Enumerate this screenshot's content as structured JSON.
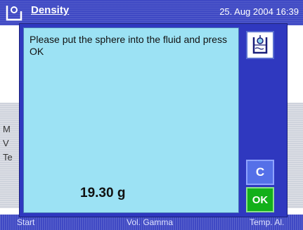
{
  "header": {
    "title": "Density",
    "date": "25. Aug 2004",
    "time": "16:39"
  },
  "background": {
    "row_labels": [
      "M",
      "V",
      "Te"
    ],
    "footer": [
      "Start",
      "Vol. Gamma",
      "Temp. Al."
    ]
  },
  "dialog": {
    "message": "Please put the sphere into the fluid and press OK",
    "weight": "19.30 g",
    "cancel_label": "C",
    "ok_label": "OK",
    "icon": "sphere-in-fluid-icon"
  },
  "colors": {
    "dialog_frame": "#2f38bf",
    "dialog_content": "#9ce2f4",
    "ok_button": "#13b01a",
    "cancel_button": "#5570e8"
  }
}
